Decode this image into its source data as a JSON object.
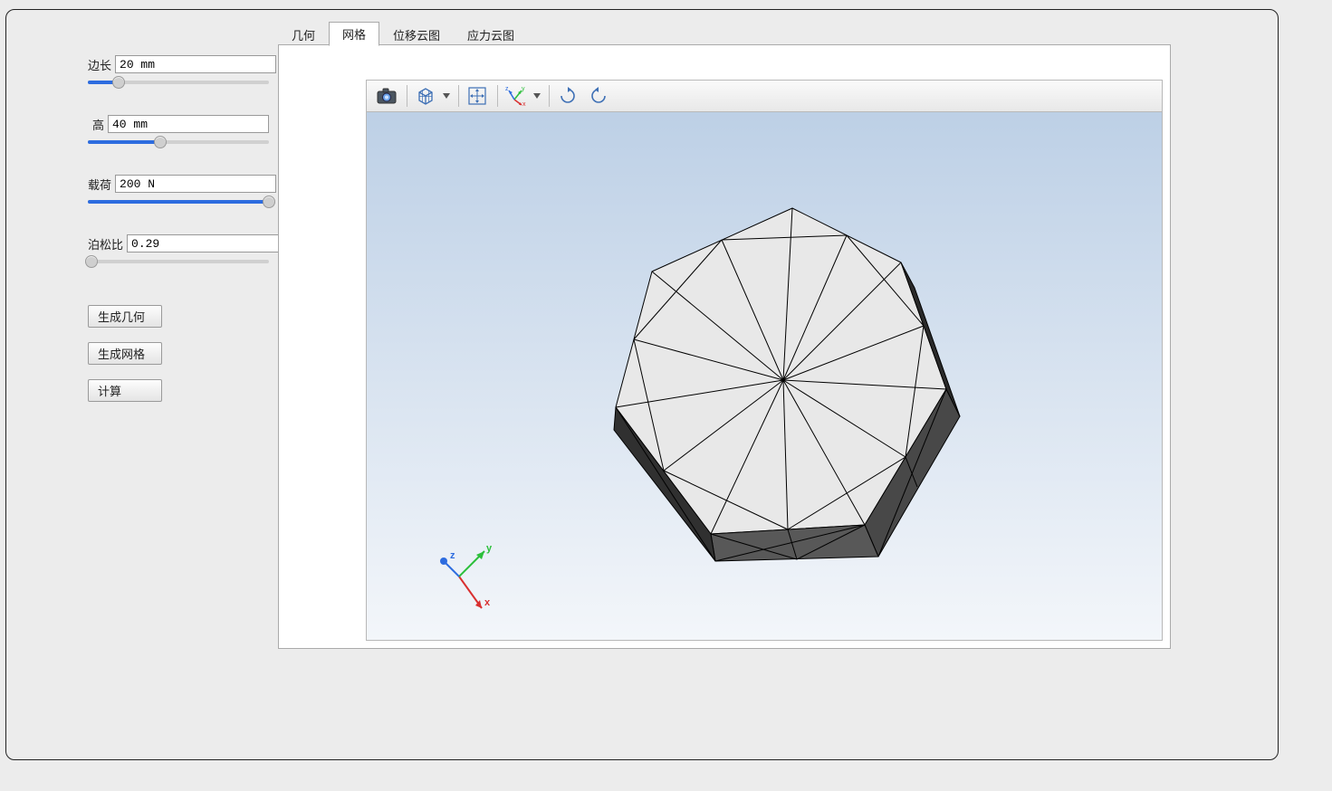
{
  "sidepanel": {
    "params": [
      {
        "label": "边长",
        "value": "20 mm",
        "slider_percent": 17
      },
      {
        "label": "高",
        "value": "40 mm",
        "slider_percent": 40
      },
      {
        "label": "载荷",
        "value": "200 N",
        "slider_percent": 100
      },
      {
        "label": "泊松比",
        "value": "0.29",
        "slider_percent": 2
      }
    ],
    "buttons": {
      "generate_geometry": "生成几何",
      "generate_mesh": "生成网格",
      "compute": "计算"
    }
  },
  "tabs": [
    {
      "label": "几何",
      "active": false
    },
    {
      "label": "网格",
      "active": true
    },
    {
      "label": "位移云图",
      "active": false
    },
    {
      "label": "应力云图",
      "active": false
    }
  ],
  "toolbar": {
    "camera_icon": "camera-icon",
    "cube_icon": "cube-icon",
    "fit_icon": "fit-view-icon",
    "axes_icon": "axes-xyz-icon",
    "rotate_cw_icon": "rotate-cw-icon",
    "rotate_ccw_icon": "rotate-ccw-icon"
  },
  "triad": {
    "x": "x",
    "y": "y",
    "z": "z"
  }
}
